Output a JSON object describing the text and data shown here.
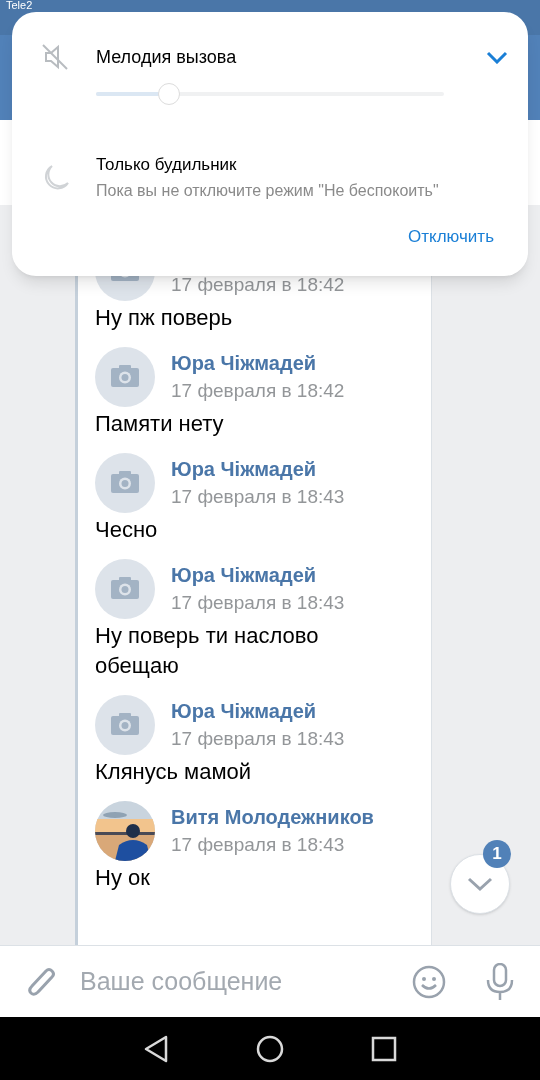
{
  "status_bar": {
    "carrier": "Tele2"
  },
  "volume_panel": {
    "title": "Мелодия вызова",
    "level": 0.21,
    "muted": true,
    "expanded": false,
    "mode_title": "Только будильник",
    "mode_subtitle": "Пока вы не отключите режим \"Не беспокоить\"",
    "action": "Отключить"
  },
  "messages": [
    {
      "kind": "camera",
      "time": "17 февраля в 18:42",
      "text": "Ну пж поверь"
    },
    {
      "kind": "camera",
      "author": "Юра Чіжмадей",
      "time": "17 февраля в 18:42",
      "text": "Памяти нету"
    },
    {
      "kind": "camera",
      "author": "Юра Чіжмадей",
      "time": "17 февраля в 18:43",
      "text": "Чесно"
    },
    {
      "kind": "camera",
      "author": "Юра Чіжмадей",
      "time": "17 февраля в 18:43",
      "text": "Ну поверь ти наслово обещаю"
    },
    {
      "kind": "camera",
      "author": "Юра Чіжмадей",
      "time": "17 февраля в 18:43",
      "text": "Клянусь мамой"
    },
    {
      "kind": "picture",
      "author": "Витя Молодежников",
      "time": "17 февраля в 18:43",
      "text": "Ну ок"
    }
  ],
  "scroll_button": {
    "badge": "1"
  },
  "composer": {
    "placeholder": "Ваше сообщение"
  }
}
